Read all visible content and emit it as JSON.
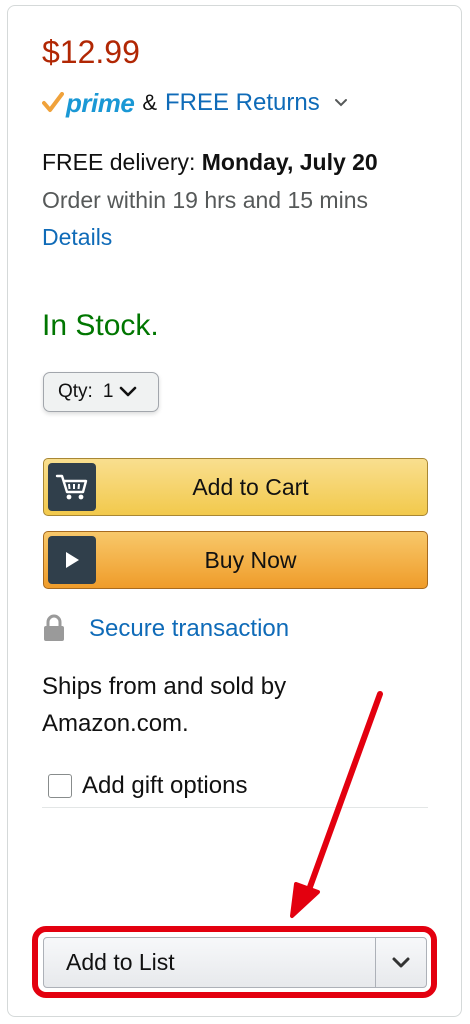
{
  "price": "$12.99",
  "prime": {
    "logo_text": "prime",
    "ampersand": "&",
    "returns_label": "FREE Returns",
    "chevron_icon": "chevron-down-icon"
  },
  "delivery": {
    "prefix": "FREE delivery: ",
    "date": "Monday, July 20",
    "order_within": "Order within 19 hrs and 15 mins",
    "details_link": "Details"
  },
  "stock": {
    "status": "In Stock.",
    "color": "#007600"
  },
  "quantity": {
    "label": "Qty:",
    "value": "1"
  },
  "buttons": {
    "add_to_cart": "Add to Cart",
    "buy_now": "Buy Now",
    "add_to_list": "Add to List"
  },
  "secure": {
    "label": "Secure transaction",
    "icon": "lock-icon"
  },
  "seller": {
    "line1": "Ships from and sold by",
    "line2": "Amazon.com."
  },
  "gift": {
    "label": "Add gift options",
    "checked": false
  },
  "colors": {
    "price": "#b12704",
    "link": "#0f6bb8",
    "prime_blue": "#1a98d5",
    "prime_check": "#f0a23b",
    "cart_button": "#f2c94c",
    "buy_button": "#ef9c2a",
    "annotation_red": "#e3000f"
  }
}
